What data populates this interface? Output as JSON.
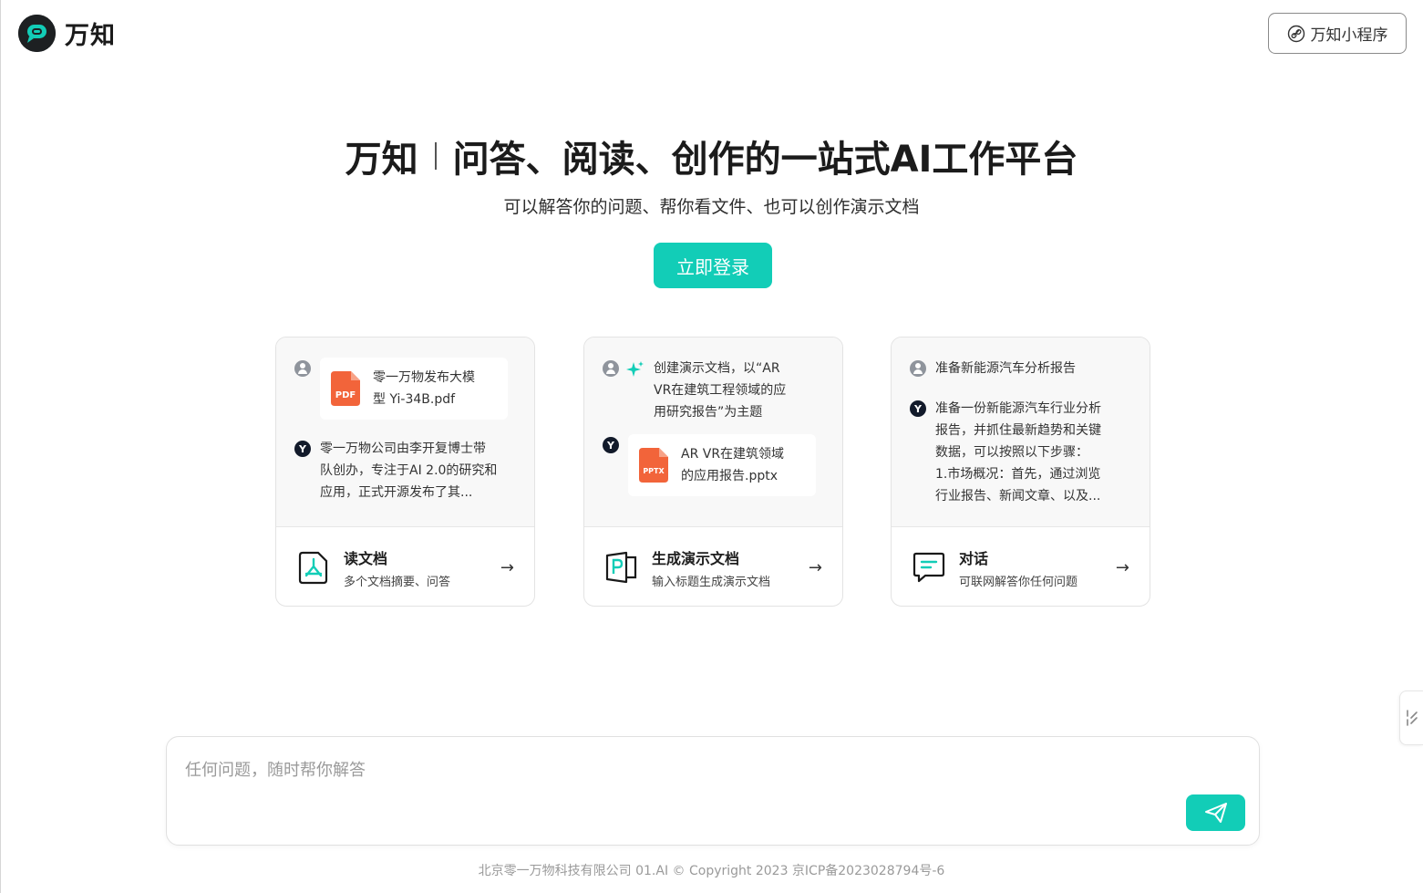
{
  "header": {
    "logo_text": "万知",
    "mini_program_label": "万知小程序"
  },
  "hero": {
    "title_brand": "万知",
    "title_main": "问答、阅读、创作的一站式AI工作平台",
    "subtitle": "可以解答你的问题、帮你看文件、也可以创作演示文档",
    "login_label": "立即登录"
  },
  "cards": [
    {
      "user_file_line1": "零一万物发布大模",
      "user_file_line2": "型 Yi-34B.pdf",
      "file_badge": "PDF",
      "bot_line1": "零一万物公司由李开复博士带",
      "bot_line2": "队创办，专注于AI 2.0的研究和",
      "bot_line3": "应用，正式开源发布了其...",
      "title": "读文档",
      "desc": "多个文档摘要、问答"
    },
    {
      "user_line1": "创建演示文档，以“AR",
      "user_line2": "VR在建筑工程领域的应",
      "user_line3": "用研究报告”为主题",
      "file_badge": "PPTX",
      "bot_file_line1": "AR VR在建筑领域",
      "bot_file_line2": "的应用报告.pptx",
      "title": "生成演示文档",
      "desc": "输入标题生成演示文档"
    },
    {
      "user_line1": "准备新能源汽车分析报告",
      "bot_line1": "准备一份新能源汽车行业分析",
      "bot_line2": "报告，并抓住最新趋势和关键",
      "bot_line3": "数据，可以按照以下步骤：",
      "bot_line4": "1.市场概况：首先，通过浏览",
      "bot_line5": "行业报告、新闻文章、以及...",
      "title": "对话",
      "desc": "可联网解答你任何问题"
    }
  ],
  "chat": {
    "placeholder": "任何问题，随时帮你解答"
  },
  "footer": {
    "text": "北京零一万物科技有限公司 01.AI © Copyright 2023 京ICP备2023028794号-6"
  },
  "colors": {
    "accent": "#12cdb7",
    "pdf": "#f2643a",
    "pptx": "#f2643a",
    "dark": "#1d2022"
  },
  "icons": {
    "logo": "speech-bubble-p-icon",
    "mini_program": "link-circle-icon",
    "user_avatar": "user-avatar-icon",
    "bot": "y-bot-icon",
    "sparkle": "sparkle-icon",
    "read_doc": "pdf-acrobat-icon",
    "ppt": "presentation-p-icon",
    "chat": "chat-bubble-icon",
    "arrow": "arrow-right-icon",
    "send": "paper-plane-icon",
    "side": "collapse-icon"
  }
}
